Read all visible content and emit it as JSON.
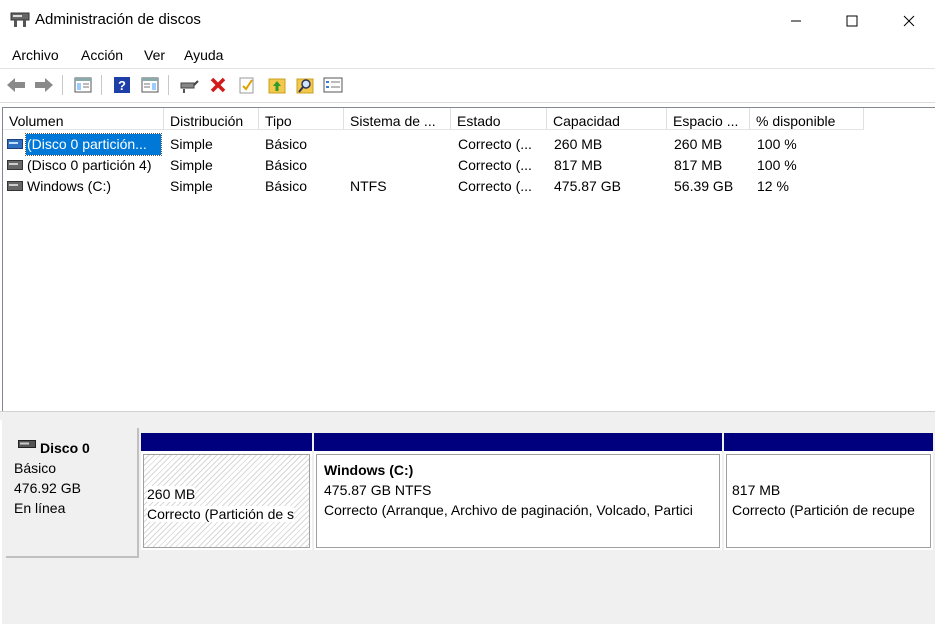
{
  "window": {
    "title": "Administración de discos",
    "icon": "disk-management-icon"
  },
  "menu": [
    "Archivo",
    "Acción",
    "Ver",
    "Ayuda"
  ],
  "toolbar": [
    "back-arrow-icon",
    "forward-arrow-icon",
    "console-tree-icon",
    "help-icon",
    "properties-icon",
    "connect-icon",
    "delete-icon",
    "check-icon",
    "up-folder-icon",
    "search-icon",
    "list-icon"
  ],
  "table": {
    "columns": [
      "Volumen",
      "Distribución",
      "Tipo",
      "Sistema de ...",
      "Estado",
      "Capacidad",
      "Espacio ...",
      "% disponible"
    ],
    "rows": [
      [
        "(Disco 0 partición...",
        "Simple",
        "Básico",
        "",
        "Correcto (...",
        "260 MB",
        "260 MB",
        "100 %"
      ],
      [
        "(Disco 0 partición 4)",
        "Simple",
        "Básico",
        "",
        "Correcto (...",
        "817 MB",
        "817 MB",
        "100 %"
      ],
      [
        "Windows (C:)",
        "Simple",
        "Básico",
        "NTFS",
        "Correcto (...",
        "475.87 GB",
        "56.39 GB",
        "12 %"
      ]
    ]
  },
  "disk": {
    "name": "Disco 0",
    "type": "Básico",
    "size": "476.92 GB",
    "status": "En línea",
    "partitions": [
      {
        "title": "",
        "size": "260 MB",
        "status": "Correcto (Partición de s"
      },
      {
        "title": "Windows  (C:)",
        "size": "475.87 GB NTFS",
        "status": "Correcto (Arranque, Archivo de paginación, Volcado, Partici"
      },
      {
        "title": "",
        "size": "817 MB",
        "status": "Correcto (Partición de recupe"
      }
    ]
  },
  "colors": {
    "partition_bar": "#00007f",
    "selection": "#0078d7"
  }
}
